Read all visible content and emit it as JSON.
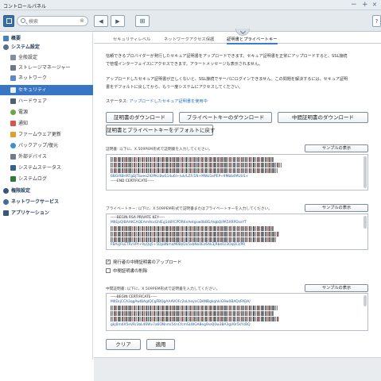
{
  "window": {
    "title": "コントロールパネル",
    "controls": {
      "minimize": "−",
      "maximize": "+",
      "close": "✕"
    }
  },
  "toolbar": {
    "search_placeholder": "検索",
    "back": "◀",
    "forward": "▶",
    "grid": "⊞",
    "help": "?"
  },
  "sidebar": {
    "items": [
      {
        "label": "概要",
        "type": "group",
        "icon": "grid-icon"
      },
      {
        "label": "システム設定",
        "type": "group",
        "icon": "gear-icon"
      },
      {
        "label": "全般設定",
        "type": "item",
        "icon": "settings-icon"
      },
      {
        "label": "ストレージマネージャー",
        "type": "item",
        "icon": "storage-icon"
      },
      {
        "label": "ネットワーク",
        "type": "item",
        "icon": "network-icon"
      },
      {
        "label": "セキュリティ",
        "type": "item",
        "icon": "shield-icon",
        "active": true
      },
      {
        "label": "ハードウェア",
        "type": "item",
        "icon": "hardware-icon"
      },
      {
        "label": "電源",
        "type": "item",
        "icon": "power-icon"
      },
      {
        "label": "通知",
        "type": "item",
        "icon": "notification-icon"
      },
      {
        "label": "ファームウェア更新",
        "type": "item",
        "icon": "firmware-icon"
      },
      {
        "label": "バックアップ/復元",
        "type": "item",
        "icon": "backup-icon"
      },
      {
        "label": "外部デバイス",
        "type": "item",
        "icon": "external-device-icon"
      },
      {
        "label": "システムステータス",
        "type": "item",
        "icon": "system-status-icon"
      },
      {
        "label": "システムログ",
        "type": "item",
        "icon": "system-log-icon"
      },
      {
        "label": "権限設定",
        "type": "group",
        "icon": "user-icon"
      },
      {
        "label": "ネットワークサービス",
        "type": "group",
        "icon": "network-service-icon"
      },
      {
        "label": "アプリケーション",
        "type": "group",
        "icon": "application-icon"
      }
    ]
  },
  "tabs": [
    {
      "label": "セキュリティレベル"
    },
    {
      "label": "ネットワークアクセス保護"
    },
    {
      "label": "証明書とプライベートキー",
      "active": true
    }
  ],
  "intro": {
    "p1_line1": "信頼できるプロバイダーが発行したセキュア証明書をアップロードできます。セキュア証明書を正常にアップロードすると、SSL接続",
    "p1_line2": "で管理インターフェイスにアクセスできます。アラートメッセージも表示されません。",
    "p2_line1": "アップロードしたセキュア証明書が正しくないと、SSL接続でサーバにログインできません。この問題を解決するには、セキュア証明",
    "p2_line2": "書をデフォルトに戻してから、もう一度システムにアクセスしてください。"
  },
  "status": {
    "label": "ステータス:",
    "value": "アップロードしたセキュア証明書を使用中"
  },
  "buttons": {
    "download_cert": "証明書のダウンロード",
    "download_key": "プライベートキーのダウンロード",
    "download_intermediate": "中間証明書のダウンロード",
    "restore_default": "証明書とプライベートキーをデフォルトに戻す",
    "clear": "クリア",
    "apply": "適用"
  },
  "certificate": {
    "label": "証明書: 以下に、X.509PEM形式で証明書を入力してください。",
    "sample_button": "サンプルの表示",
    "visible_line": "6BGiRBHRTgDJTbxeo2IOPKc8wS14u6I+/uk/LZF/1N+MWz1xPEP+9Mbb4MUU1+",
    "end_line": "-----END CERTIFICATE-----"
  },
  "private_key": {
    "label": "プライベートキー: 以下に、X.509PEM形式で証明書またはプライベートキーを入力してください。",
    "sample_button": "サンプルの表示",
    "begin_line": "-----BEGIN RSA PRIVATE KEY-----",
    "first_line": "MIIEpQIBAAKCAQEAm9cxGhlEg1d8YCPOR6nAetgsw0bBG/HqbQiPA5XRPDsxYT",
    "last_line": "FBALJFLETRcVPt+9yQq5+5Dp8NmaM0BzDx5xbNo0Ez6Ak3jRbeI1I3OqQi3/PR"
  },
  "checkboxes": {
    "upload_intermediate": {
      "label": "発行者の中間証明書のアップロード",
      "checked": true
    },
    "remove_intermediate": {
      "label": "中間証明書の削除",
      "checked": false
    }
  },
  "intermediate": {
    "label": "中間証明書: 以下に、X.509PEM形式で証明書を入力してください。",
    "sample_button": "サンプルの表示",
    "begin_line": "-----BEGIN CERTIFICATE-----",
    "first_line": "MIIEkjCCA3qgAwIBAgIQCgFBQgAAAVOFc2oLheynCDANBgkqhkiG9w0BAQsFADA/",
    "last_line": "gkJ0m6X5eVR/3bLd6Wv7a6ONnmi54nCfcmSLWGA8eg9/eQ0w3BA3gV0r5kYcBQ"
  }
}
